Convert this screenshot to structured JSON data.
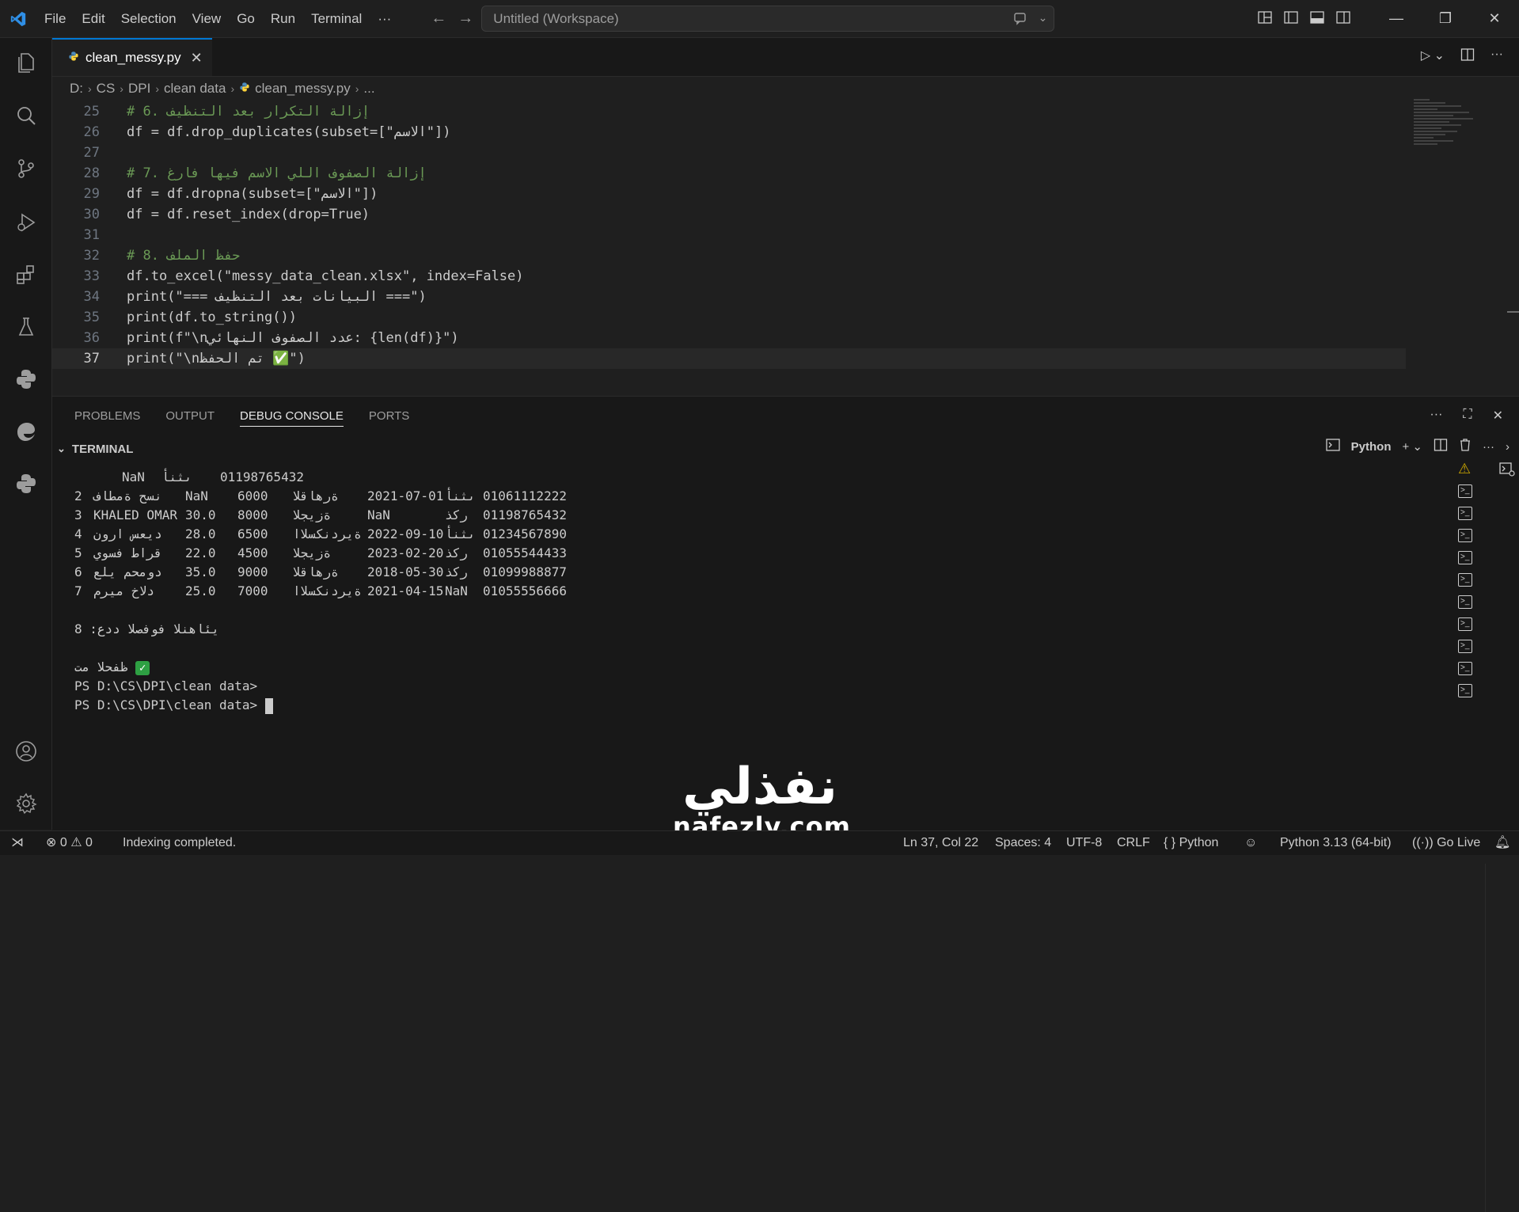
{
  "titlebar": {
    "menu": [
      "File",
      "Edit",
      "Selection",
      "View",
      "Go",
      "Run",
      "Terminal",
      "···"
    ],
    "search_text": "Untitled (Workspace)"
  },
  "tab": {
    "filename": "clean_messy.py",
    "close": "✕"
  },
  "breadcrumb": [
    "D:",
    "CS",
    "DPI",
    "clean data",
    "clean_messy.py",
    "..."
  ],
  "code": {
    "line_numbers": [
      "25",
      "26",
      "27",
      "28",
      "29",
      "30",
      "31",
      "32",
      "33",
      "34",
      "35",
      "36",
      "37"
    ],
    "lines": [
      "# 6. إزالة التكرار بعد التنظيف",
      "df = df.drop_duplicates(subset=[\"الاسم\"])",
      "",
      "# 7. إزالة الصفوف اللي الاسم فيها فارغ",
      "df = df.dropna(subset=[\"الاسم\"])",
      "df = df.reset_index(drop=True)",
      "",
      "# 8. حفظ الملف",
      "df.to_excel(\"messy_data_clean.xlsx\", index=False)",
      "print(\"=== البيانات بعد التنظيف ===\")",
      "print(df.to_string())",
      "print(f\"\\nعدد الصفوف النهائي: {len(df)}\")",
      "print(\"\\nتم الحفظ ✅\")"
    ]
  },
  "panel": {
    "tabs": [
      "PROBLEMS",
      "OUTPUT",
      "DEBUG CONSOLE",
      "PORTS"
    ],
    "active_tab": "DEBUG CONSOLE",
    "terminal_label": "TERMINAL",
    "shell_name": "Python"
  },
  "terminal": {
    "first_row": {
      "c1": "NaN",
      "c2": "ىثنأ",
      "c3": "01198765432"
    },
    "rows": [
      {
        "idx": "2",
        "name": "نسح ةمطاف",
        "age": "NaN",
        "salary": "6000",
        "city": "ةرهاقلا",
        "date": "2021-07-01",
        "gender": "ىثنأ",
        "phone": "01061112222"
      },
      {
        "idx": "3",
        "name": "KHALED OMAR",
        "age": "30.0",
        "salary": "8000",
        "city": "ةزيجلا",
        "date": "NaN",
        "gender": "ركذ",
        "phone": "01198765432"
      },
      {
        "idx": "4",
        "name": "ديعس ارون",
        "age": "28.0",
        "salary": "6500",
        "city": "ةيردنكسلاا",
        "date": "2022-09-10",
        "gender": "ىثنأ",
        "phone": "01234567890"
      },
      {
        "idx": "5",
        "name": "قراط فسوي",
        "age": "22.0",
        "salary": "4500",
        "city": "ةزيجلا",
        "date": "2023-02-20",
        "gender": "ركذ",
        "phone": "01055544433"
      },
      {
        "idx": "6",
        "name": "دومحم يلع",
        "age": "35.0",
        "salary": "9000",
        "city": "ةرهاقلا",
        "date": "2018-05-30",
        "gender": "ركذ",
        "phone": "01099988877"
      },
      {
        "idx": "7",
        "name": "دلاخ ميرم",
        "age": "25.0",
        "salary": "7000",
        "city": "ةيردنكسلاا",
        "date": "2021-04-15",
        "gender": "NaN",
        "phone": "01055556666"
      }
    ],
    "count_line": "يئاهنلا فوفصلا ددع: 8",
    "saved_text": "ظفحلا مت",
    "prompt1": "PS D:\\CS\\DPI\\clean data>",
    "prompt2": "PS D:\\CS\\DPI\\clean data>"
  },
  "status": {
    "errors": "0",
    "warnings": "0",
    "message": "Indexing completed.",
    "position": "Ln 37, Col 22",
    "spaces": "Spaces: 4",
    "encoding": "UTF-8",
    "eol": "CRLF",
    "language": "Python",
    "interpreter": "Python 3.13 (64-bit)",
    "golive": "Go Live"
  },
  "watermark": {
    "arabic": "نفذلي",
    "latin": "nafezly.com"
  },
  "colors": {
    "accent": "#0078d4",
    "editor_bg": "#1f1f1f",
    "panel_bg": "#181818"
  }
}
